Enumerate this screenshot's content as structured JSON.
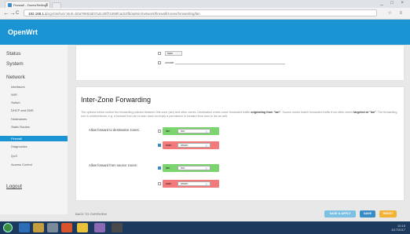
{
  "browser": {
    "tab_title": "Firewall - Zones/Settings",
    "url_host": "192.168.1.1",
    "url_rest": "/cgi-bin/luci/;stok=b0a79863d07a2c29f72459fcadc0fb/admin/network/firewall/zones/forwarding/lan",
    "nav_back": "←",
    "nav_forward": "→",
    "nav_reload": "C",
    "window_controls": "_ □ ×",
    "toolbar_icons": "☆ ≡"
  },
  "brand": "OpenWrt",
  "sidebar": {
    "status": "Status",
    "system": "System",
    "network": "Network",
    "items": [
      "Interfaces",
      "WiFi",
      "Switch",
      "DHCP and DNS",
      "Hostnames",
      "Static Routes",
      "Firewall",
      "Diagnostics",
      "QoS",
      "Access Control"
    ],
    "logout": "Logout"
  },
  "top_panel": {
    "field_value": "lwan",
    "row_label": "create:"
  },
  "section": {
    "title": "Inter-Zone Forwarding",
    "description_a": "The options below control the forwarding policies between this zone (lan) and other zones. Destination zones cover forwarded traffic ",
    "description_b": "originating from \"lan\"",
    "description_c": ". Source zones match forwarded traffic from other zones ",
    "description_d": "targeted at \"lan\"",
    "description_e": ". The forwarding rule is unidirectional, e.g. a forward from lan to wan does not imply a permission to forward from wan to lan as well."
  },
  "forward_dest": {
    "label": "Allow forward to destination zones:",
    "zones": [
      {
        "name": "lan",
        "chip": "lan:",
        "color": "#7bd56f"
      },
      {
        "name": "wan",
        "chip": "wwan:",
        "color": "#f37a7a"
      }
    ]
  },
  "forward_src": {
    "label": "Allow forward from source zones:",
    "zones": [
      {
        "name": "lan",
        "chip": "lan:",
        "color": "#7bd56f"
      },
      {
        "name": "wan",
        "chip": "wwan:",
        "color": "#f37a7a"
      }
    ]
  },
  "footer": {
    "back": "BACK TO OVERVIEW",
    "save_apply": "SAVE & APPLY",
    "save": "SAVE",
    "reset": "RESET"
  },
  "taskbar": {
    "tray_time": "10:15",
    "tray_date": "3/17/2017"
  }
}
